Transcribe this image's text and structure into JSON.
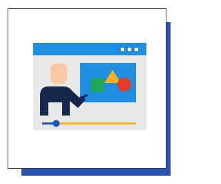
{
  "icon": {
    "name": "online-presentation-icon",
    "colors": {
      "card_shadow": "#2b53b4",
      "card_border": "#3a3a3a",
      "window_bar": "#1f8ee0",
      "window_body": "#e8e8e8",
      "screen": "#1f8ee0",
      "square": "#1ea855",
      "triangle": "#f5b21a",
      "circle": "#e63a2b",
      "presenter_head": "#f6c8a4",
      "presenter_body": "#15284b",
      "progress_track": "#f5b21a",
      "progress_fill": "#1a56c4",
      "progress_knob": "#1a56c4",
      "dots": "#ffffff"
    },
    "progress": 0.15
  }
}
